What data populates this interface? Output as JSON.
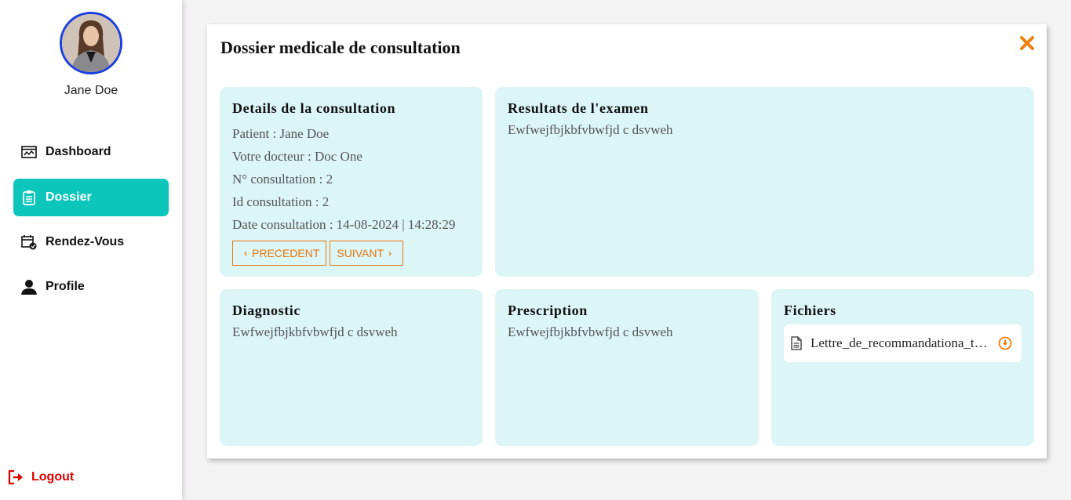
{
  "user": {
    "name": "Jane Doe"
  },
  "sidebar": {
    "items": [
      {
        "label": "Dashboard",
        "icon": "dashboard-icon",
        "active": false
      },
      {
        "label": "Dossier",
        "icon": "clipboard-icon",
        "active": true
      },
      {
        "label": "Rendez-Vous",
        "icon": "calendar-icon",
        "active": false
      },
      {
        "label": "Profile",
        "icon": "user-icon",
        "active": false
      }
    ],
    "logout": "Logout"
  },
  "colors": {
    "accent": "#0cc6bb",
    "orange": "#e8760c",
    "logout": "#e00000",
    "card_bg": "#dcf5f6"
  },
  "modal": {
    "title": "Dossier medicale de consultation",
    "details": {
      "title": "Details de la consultation",
      "patient": "Patient : Jane Doe",
      "doctor": "Votre docteur : Doc One",
      "number": "N° consultation : 2",
      "id": "Id consultation : 2",
      "date": "Date consultation : 14-08-2024 | 14:28:29",
      "prev_label": "PRECEDENT",
      "next_label": "SUIVANT"
    },
    "resultats": {
      "title": "Resultats de l'examen",
      "text": "Ewfwejfbjkbfvbwfjd c dsvweh"
    },
    "diagnostic": {
      "title": "Diagnostic",
      "text": "Ewfwejfbjkbfvbwfjd c dsvweh"
    },
    "prescription": {
      "title": "Prescription",
      "text": "Ewfwejfbjkbfvbwfjd c dsvweh"
    },
    "fichiers": {
      "title": "Fichiers",
      "file_name": "Lettre_de_recommandationa_tres_long_nom.pdf"
    }
  }
}
